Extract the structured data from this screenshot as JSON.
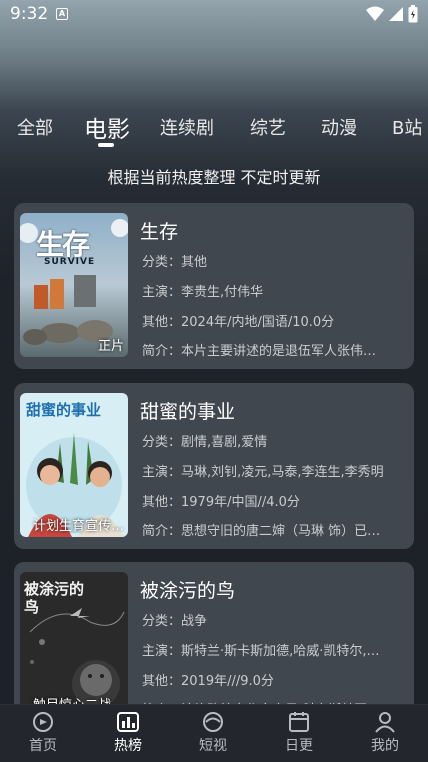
{
  "status": {
    "time": "9:32",
    "a_icon": "A"
  },
  "tabs": [
    {
      "label": "全部"
    },
    {
      "label": "电影"
    },
    {
      "label": "连续剧"
    },
    {
      "label": "综艺"
    },
    {
      "label": "动漫"
    },
    {
      "label": "B站"
    }
  ],
  "active_tab": "电影",
  "subtitle": "根据当前热度整理 不定时更新",
  "movies": [
    {
      "title": "生存",
      "poster_title": "生存",
      "poster_subtitle": "SURVIVE",
      "poster_tag": "正片",
      "category": "分类：其他",
      "cast": "主演：李贵生,付伟华",
      "other": "其他：2024年/内地/国语/10.0分",
      "intro": "简介：本片主要讲述的是退伍军人张伟…"
    },
    {
      "title": "甜蜜的事业",
      "poster_title": "甜蜜的事业",
      "poster_tag": "计划生育宣传…",
      "category": "分类：剧情,喜剧,爱情",
      "cast": "主演：马琳,刘钊,凌元,马泰,李连生,李秀明",
      "other": "其他：1979年/中国//4.0分",
      "intro": "简介：思想守旧的唐二婶（马琳 饰）已…"
    },
    {
      "title": "被涂污的鸟",
      "poster_title": "被涂污的鸟",
      "poster_tag": "触目惊心二战…",
      "category": "分类：战争",
      "cast": "主演：斯特兰·斯卡斯加德,哈威·凯特尔,…",
      "other": "其他：2019年///9.0分",
      "intro": "简介：该片改编自作家杰日·科辛斯基同…"
    }
  ],
  "bottom_nav": [
    {
      "label": "首页",
      "icon": "home-icon"
    },
    {
      "label": "热榜",
      "icon": "chart-icon"
    },
    {
      "label": "短视",
      "icon": "video-icon"
    },
    {
      "label": "日更",
      "icon": "calendar-icon"
    },
    {
      "label": "我的",
      "icon": "profile-icon"
    }
  ],
  "active_nav": "热榜"
}
